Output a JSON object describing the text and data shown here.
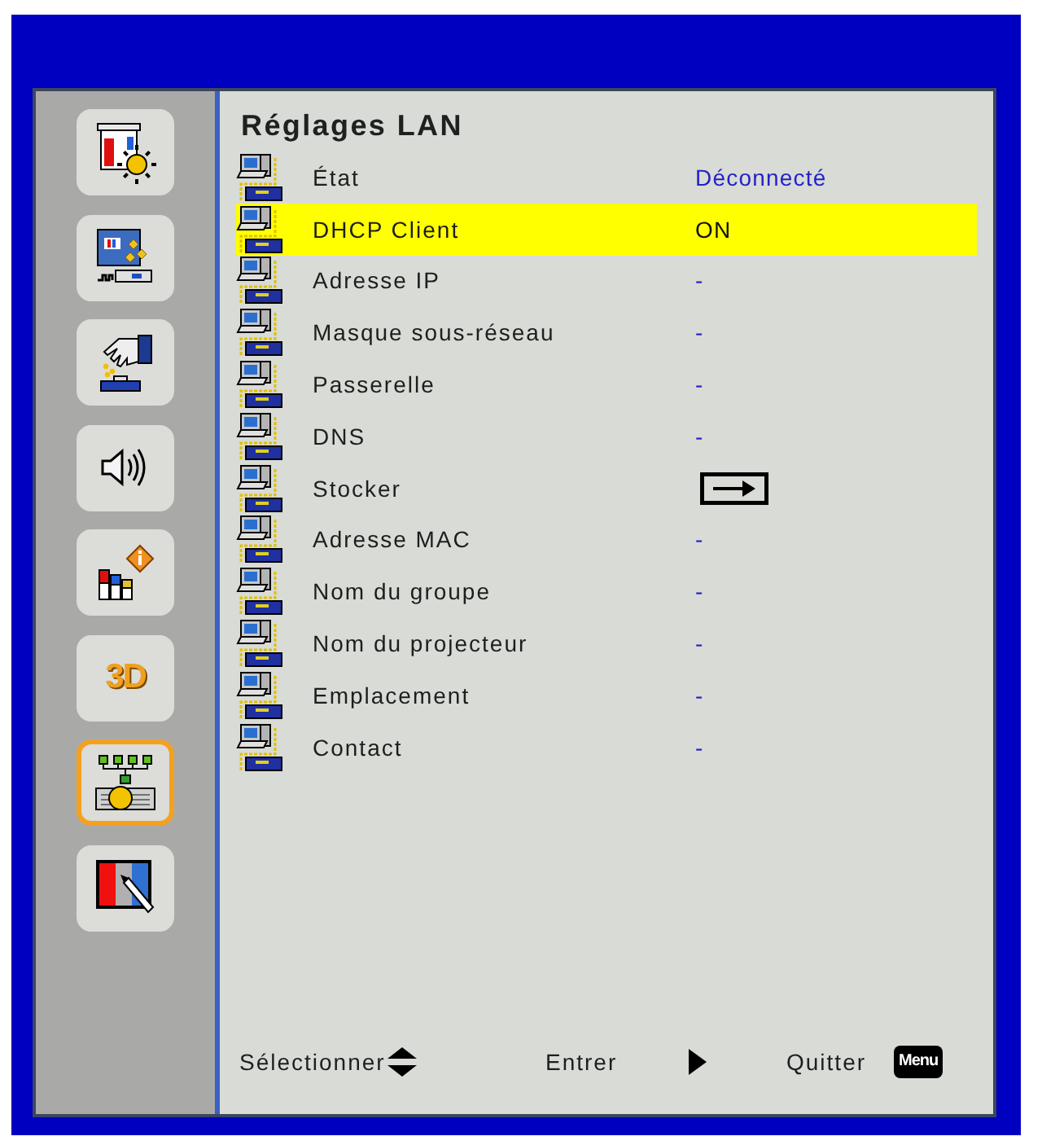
{
  "sidebar": {
    "items": [
      {
        "kind": "brightness",
        "selected": false
      },
      {
        "kind": "display",
        "selected": false
      },
      {
        "kind": "setup",
        "selected": false
      },
      {
        "kind": "audio",
        "selected": false
      },
      {
        "kind": "info",
        "selected": false
      },
      {
        "kind": "label",
        "label": "3D",
        "selected": false
      },
      {
        "kind": "network",
        "selected": true
      },
      {
        "kind": "color",
        "selected": false
      }
    ]
  },
  "title": "Réglages LAN",
  "rows": [
    {
      "kind": "value",
      "label": "État",
      "value": "Déconnecté",
      "selected": false
    },
    {
      "kind": "value",
      "label": "DHCP Client",
      "value": "ON",
      "selected": true
    },
    {
      "kind": "value",
      "label": "Adresse IP",
      "value": "-",
      "selected": false
    },
    {
      "kind": "value",
      "label": "Masque sous-réseau",
      "value": "-",
      "selected": false
    },
    {
      "kind": "value",
      "label": "Passerelle",
      "value": "-",
      "selected": false
    },
    {
      "kind": "value",
      "label": "DNS",
      "value": "-",
      "selected": false
    },
    {
      "kind": "action",
      "label": "Stocker",
      "selected": false
    },
    {
      "kind": "value",
      "label": "Adresse MAC",
      "value": "-",
      "selected": false
    },
    {
      "kind": "value",
      "label": "Nom du groupe",
      "value": "-",
      "selected": false
    },
    {
      "kind": "value",
      "label": "Nom du projecteur",
      "value": "-",
      "selected": false
    },
    {
      "kind": "value",
      "label": "Emplacement",
      "value": "-",
      "selected": false
    },
    {
      "kind": "value",
      "label": "Contact",
      "value": "-",
      "selected": false
    }
  ],
  "footer": {
    "hints": [
      {
        "kind": "updown",
        "label": "Sélectionner"
      },
      {
        "kind": "right",
        "label": "Entrer"
      },
      {
        "kind": "key",
        "label": "Quitter",
        "key": "Menu"
      }
    ]
  }
}
